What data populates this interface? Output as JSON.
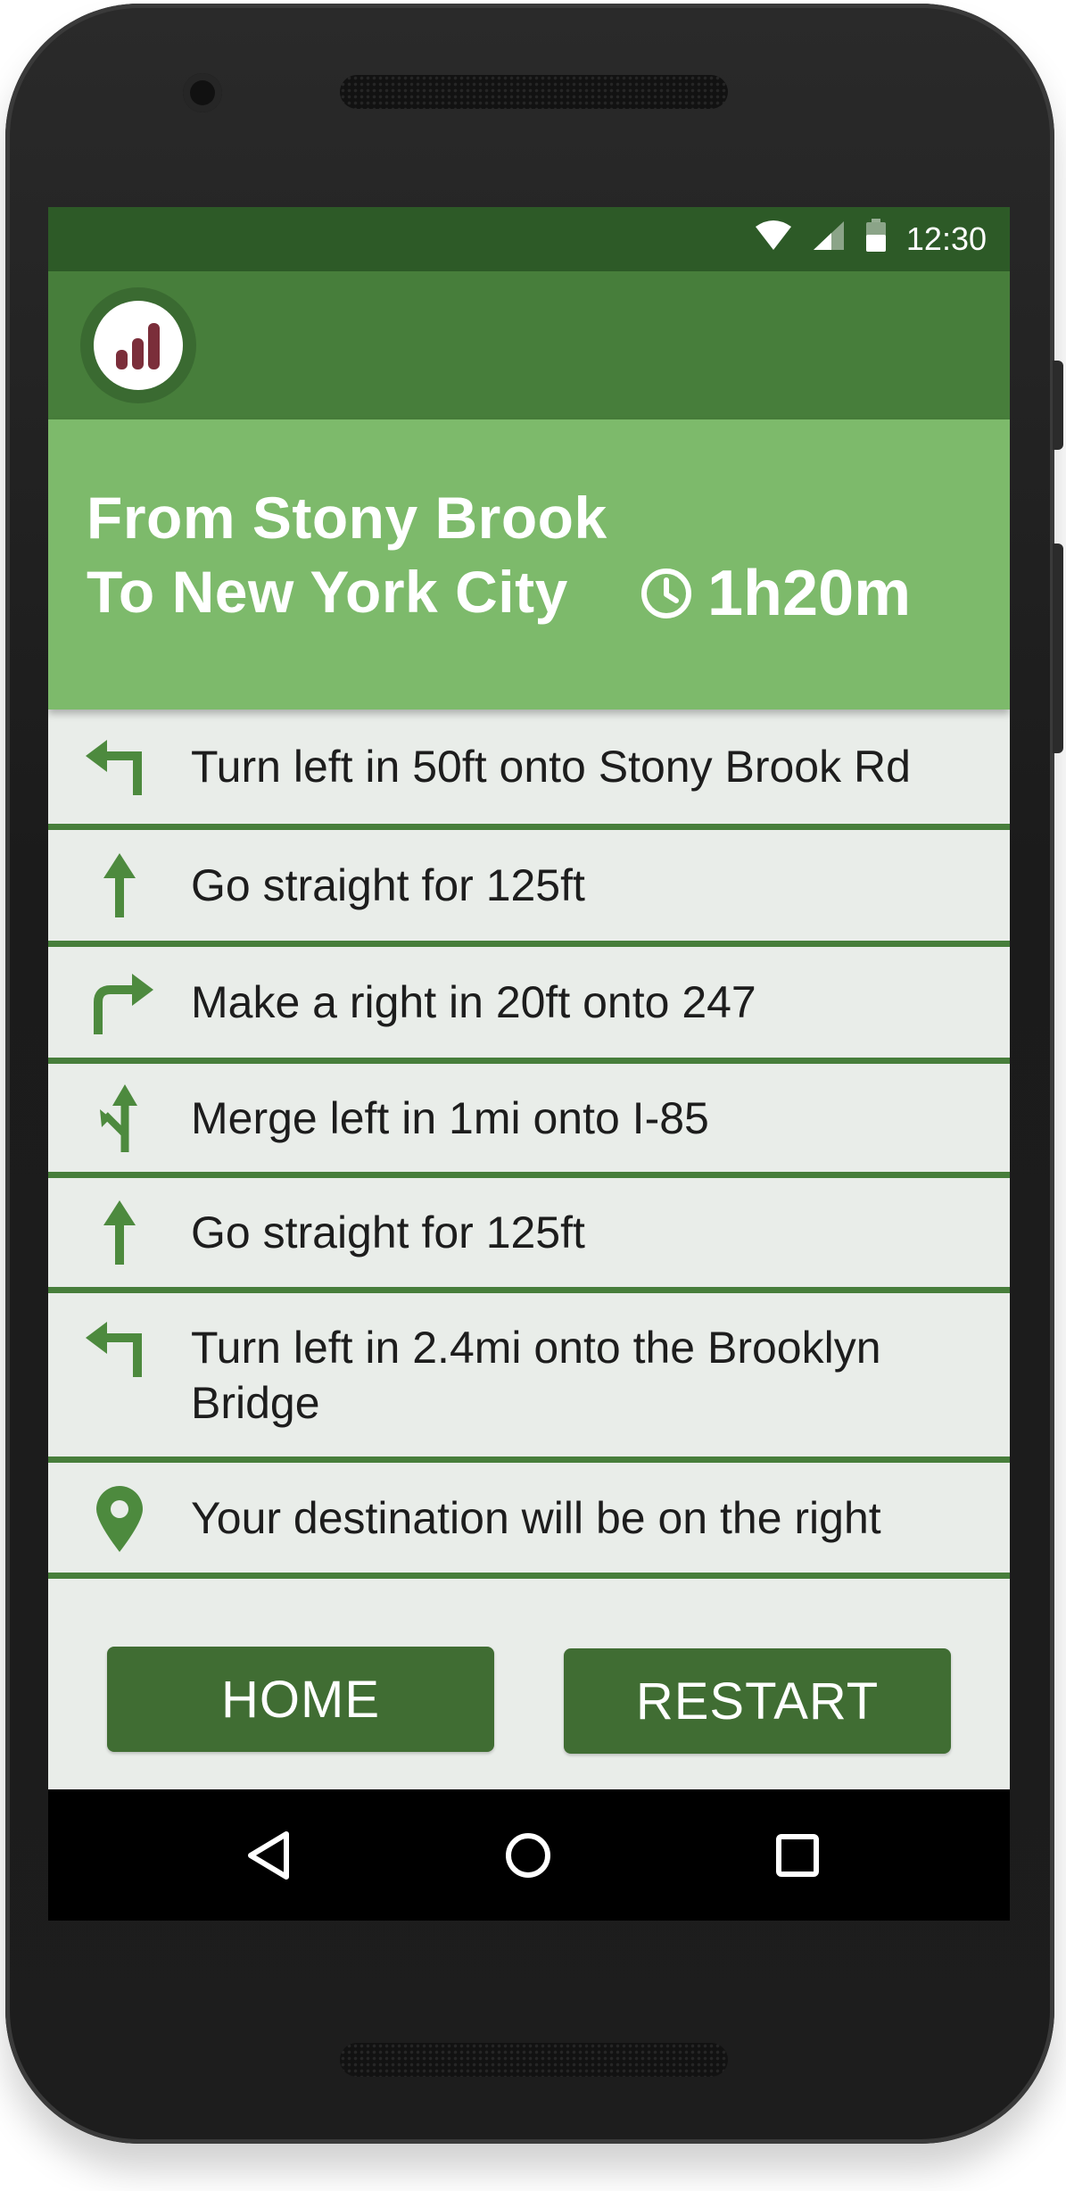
{
  "status_bar": {
    "time": "12:30",
    "icons": [
      "wifi-icon",
      "signal-icon",
      "battery-icon"
    ]
  },
  "app_bar": {
    "logo_icon": "bar-chart-icon"
  },
  "route": {
    "from": "From Stony Brook",
    "to": "To New York City",
    "eta_icon": "clock-icon",
    "eta": "1h20m"
  },
  "directions": [
    {
      "icon": "turn-left-icon",
      "text": "Turn left in 50ft onto Stony Brook Rd"
    },
    {
      "icon": "straight-arrow-icon",
      "text": "Go straight for 125ft"
    },
    {
      "icon": "turn-right-icon",
      "text": "Make a right in 20ft onto 247"
    },
    {
      "icon": "merge-left-icon",
      "text": "Merge left in 1mi onto I-85"
    },
    {
      "icon": "straight-arrow-icon",
      "text": "Go straight for 125ft"
    },
    {
      "icon": "turn-left-icon",
      "text": "Turn left in 2.4mi onto the Brooklyn Bridge"
    },
    {
      "icon": "location-pin-icon",
      "text": "Your destination will be on the right"
    }
  ],
  "buttons": {
    "home": "HOME",
    "restart": "RESTART"
  },
  "nav_bar": [
    "back-icon",
    "home-circle-icon",
    "recents-icon"
  ],
  "colors": {
    "status_bar": "#2d5a27",
    "app_bar": "#477e3b",
    "header": "#7dba6b",
    "background": "#e9ede9",
    "accent": "#406d33",
    "icon_green": "#4d8a3e",
    "logo_bars": "#7b2e3a"
  }
}
